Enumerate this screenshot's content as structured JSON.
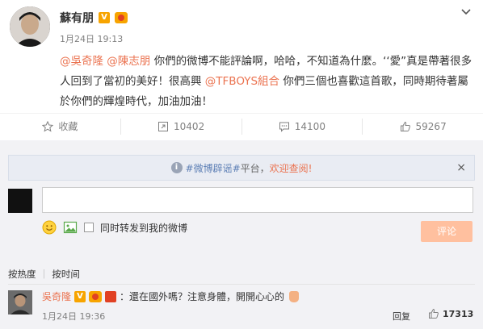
{
  "post": {
    "author": "蘇有朋",
    "time": "1月24日 19:13",
    "content": {
      "mention1": "@吳奇隆",
      "mention2": "@陳志朋",
      "text1": " 你們的微博不能評論啊，哈哈，不知道為什麼。‘‘愛”真是帶著很多人回到了當初的美好！很高興",
      "mention3": "@TFBOYS組合",
      "text2": " 你們三個也喜歡這首歌，同時期待著屬於你們的輝煌時代，加油加油！"
    }
  },
  "actions": {
    "favorite": "收藏",
    "repost_count": "10402",
    "comment_count": "14100",
    "like_count": "59267"
  },
  "notice": {
    "hashtag": "#微博辟谣#",
    "middle": "平台，",
    "link": "欢迎查阅!",
    "close": "×"
  },
  "composer": {
    "repost_label": "同时转发到我的微博",
    "submit_label": "评论"
  },
  "sort": {
    "by_hot": "按热度",
    "separator": "|",
    "by_time": "按时间"
  },
  "comment": {
    "name": "吳奇隆",
    "text": "：還在國外嗎？注意身體，開開心心的",
    "time": "1月24日 19:36",
    "reply": "回复",
    "likes": "17313"
  },
  "colors": {
    "accent": "#eb7350",
    "badge": "#f7a400",
    "submit_disabled": "#ffc09f",
    "comments_bg": "#f2f2f5"
  }
}
